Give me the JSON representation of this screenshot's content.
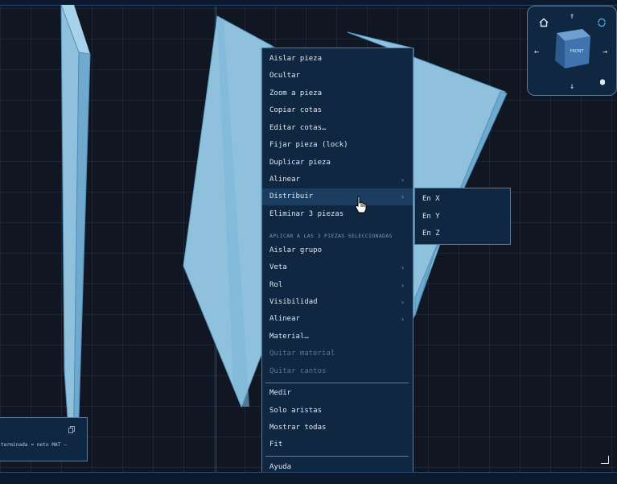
{
  "context_menu": {
    "items": [
      {
        "label": "Aislar pieza"
      },
      {
        "label": "Ocultar"
      },
      {
        "label": "Zoom a pieza"
      },
      {
        "label": "Copiar cotas"
      },
      {
        "label": "Editar cotas…"
      },
      {
        "label": "Fijar pieza (lock)"
      },
      {
        "label": "Duplicar pieza"
      },
      {
        "label": "Alinear",
        "submenu_arrow": "›"
      },
      {
        "label": "Distribuir",
        "submenu_arrow": "›"
      },
      {
        "label": "Eliminar 3 piezas"
      }
    ],
    "group_header": "APLICAR A LAS 3 PIEZAS SELECCIONADAS",
    "group_items": [
      {
        "label": "Aislar grupo"
      },
      {
        "label": "Veta",
        "submenu_arrow": "›"
      },
      {
        "label": "Rol",
        "submenu_arrow": "›"
      },
      {
        "label": "Visibilidad",
        "submenu_arrow": "›"
      },
      {
        "label": "Alinear",
        "submenu_arrow": "›"
      },
      {
        "label": "Material…"
      },
      {
        "label": "Quitar material"
      },
      {
        "label": "Quitar cantos"
      }
    ],
    "view_items": [
      {
        "label": "Medir"
      },
      {
        "label": "Solo aristas"
      },
      {
        "label": "Mostrar todas"
      },
      {
        "label": "Fit"
      }
    ],
    "help": {
      "label": "Ayuda"
    }
  },
  "submenu": {
    "items": [
      {
        "label": "En X"
      },
      {
        "label": "En Y"
      },
      {
        "label": "En Z"
      }
    ]
  },
  "viewcube": {
    "home_icon": "home-icon",
    "sync_icon": "rotate-icon",
    "arrow_up": "↑",
    "arrow_down": "↓",
    "arrow_left": "←",
    "arrow_right": "→",
    "cube_face_label": "FRONT"
  },
  "info_panel": {
    "text": "terminada = neto   MAT —",
    "copy_icon": "copy-icon"
  },
  "colors": {
    "background": "#111722",
    "menu_bg": "#0f2741",
    "menu_border": "#5c7a99",
    "piece_fill": "#8fc1dd",
    "piece_edge": "#5aa0c8"
  }
}
